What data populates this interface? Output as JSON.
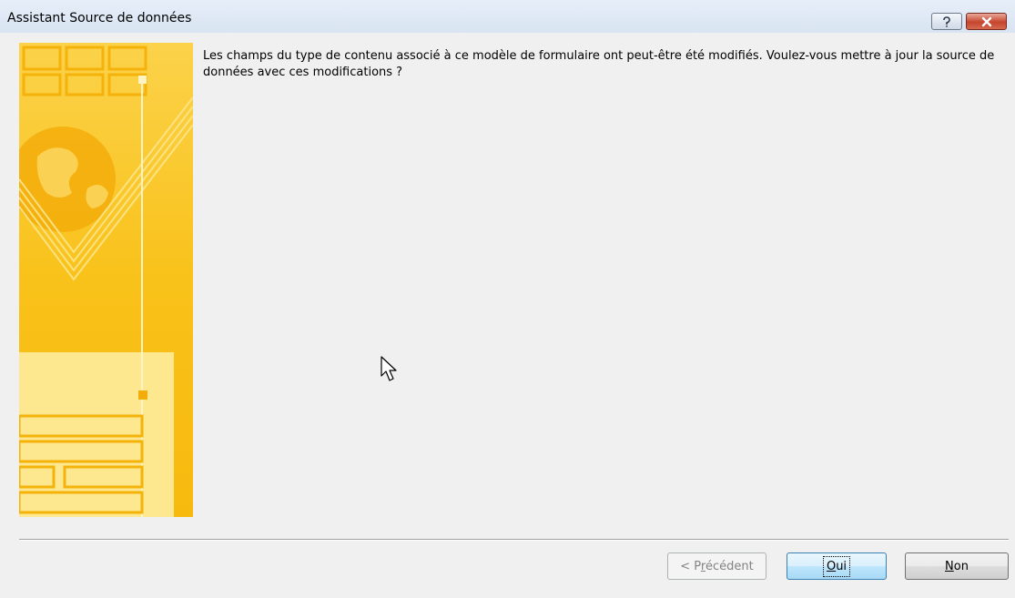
{
  "window": {
    "title": "Assistant Source de données",
    "help_symbol": "?",
    "close_symbol": "✕"
  },
  "message": "Les champs du type de contenu associé à ce modèle de formulaire ont peut-être été modifiés. Voulez-vous mettre à jour la source de données avec ces modifications ?",
  "buttons": {
    "previous": {
      "before": "< P",
      "mnemonic": "r",
      "after": "écédent"
    },
    "yes": {
      "mnemonic": "O",
      "after": "ui"
    },
    "no": {
      "mnemonic": "N",
      "after": "on"
    }
  },
  "colors": {
    "sidebar_gold": "#f9c21a",
    "sidebar_light": "#fde58a",
    "close_red": "#c6452d"
  },
  "icons": {
    "help": "question-mark",
    "close": "x-mark",
    "cursor": "arrow-pointer",
    "sidebar": "wizard-globe-form-illustration"
  }
}
